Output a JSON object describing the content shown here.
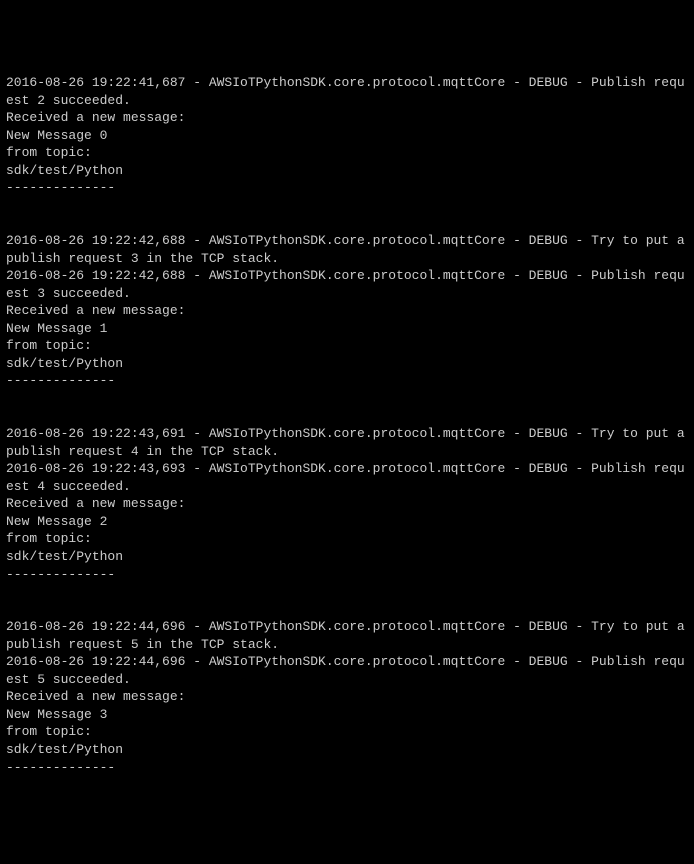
{
  "blocks": [
    {
      "lines": [
        "2016-08-26 19:22:41,687 - AWSIoTPythonSDK.core.protocol.mqttCore - DEBUG - Publish request 2 succeeded.",
        "Received a new message: ",
        "New Message 0",
        "from topic: ",
        "sdk/test/Python",
        "--------------"
      ]
    },
    {
      "lines": [
        "2016-08-26 19:22:42,688 - AWSIoTPythonSDK.core.protocol.mqttCore - DEBUG - Try to put a publish request 3 in the TCP stack.",
        "2016-08-26 19:22:42,688 - AWSIoTPythonSDK.core.protocol.mqttCore - DEBUG - Publish request 3 succeeded.",
        "Received a new message: ",
        "New Message 1",
        "from topic: ",
        "sdk/test/Python",
        "--------------"
      ]
    },
    {
      "lines": [
        "2016-08-26 19:22:43,691 - AWSIoTPythonSDK.core.protocol.mqttCore - DEBUG - Try to put a publish request 4 in the TCP stack.",
        "2016-08-26 19:22:43,693 - AWSIoTPythonSDK.core.protocol.mqttCore - DEBUG - Publish request 4 succeeded.",
        "Received a new message: ",
        "New Message 2",
        "from topic: ",
        "sdk/test/Python",
        "--------------"
      ]
    },
    {
      "lines": [
        "2016-08-26 19:22:44,696 - AWSIoTPythonSDK.core.protocol.mqttCore - DEBUG - Try to put a publish request 5 in the TCP stack.",
        "2016-08-26 19:22:44,696 - AWSIoTPythonSDK.core.protocol.mqttCore - DEBUG - Publish request 5 succeeded.",
        "Received a new message: ",
        "New Message 3",
        "from topic: ",
        "sdk/test/Python",
        "--------------"
      ]
    }
  ]
}
